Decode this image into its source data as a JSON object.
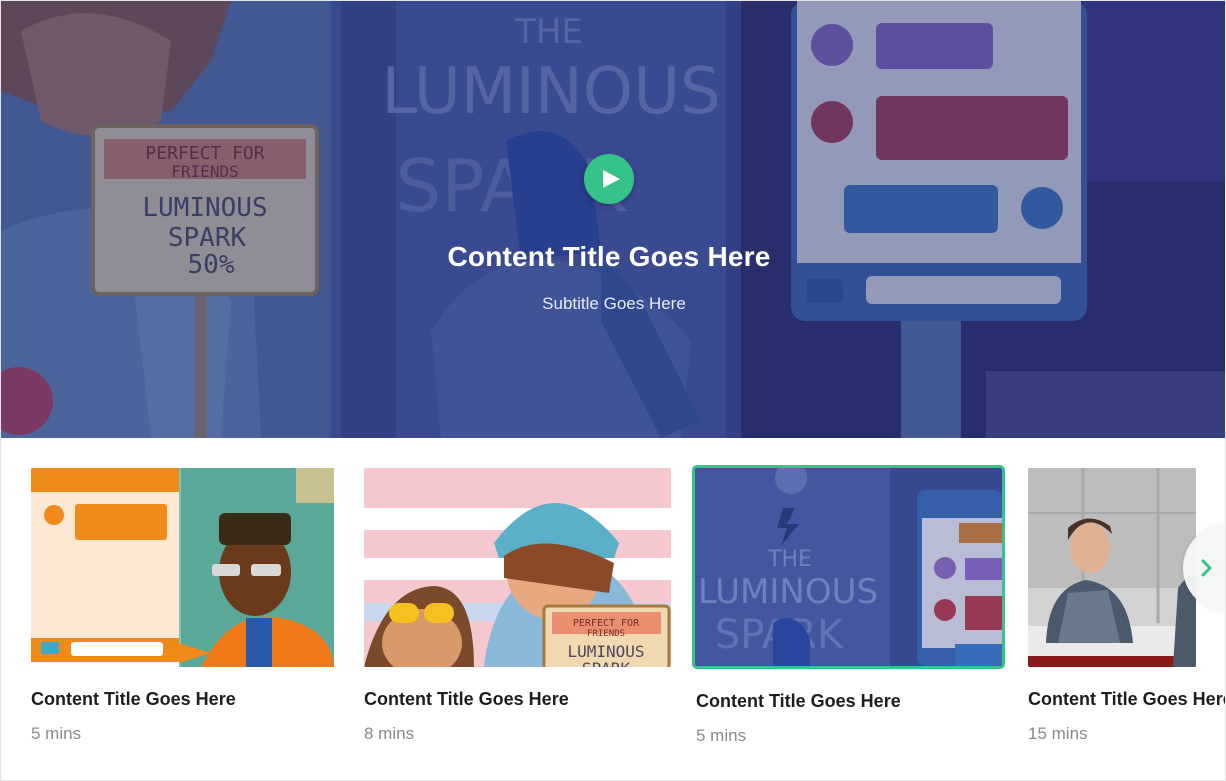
{
  "hero": {
    "title": "Content Title Goes Here",
    "subtitle": "Subtitle Goes Here",
    "art_sign": [
      "PERFECT FOR",
      "FRIENDS",
      "LUMINOUS",
      "SPARK",
      "50%"
    ],
    "art_poster": [
      "THE",
      "LUMINOUS",
      "SPARK"
    ]
  },
  "cards": [
    {
      "title": "Content Title Goes Here",
      "duration": "5 mins",
      "selected": false
    },
    {
      "title": "Content Title Goes Here",
      "duration": "8 mins",
      "selected": false,
      "art_sign": [
        "PERFECT FOR",
        "FRIENDS",
        "LUMINOUS",
        "SPARK"
      ]
    },
    {
      "title": "Content Title Goes Here",
      "duration": "5 mins",
      "selected": true,
      "art_poster": [
        "THE",
        "LUMINOUS",
        "SPARK"
      ]
    },
    {
      "title": "Content Title Goes Here",
      "duration": "15 mins",
      "selected": false
    }
  ],
  "colors": {
    "accent": "#35c38a",
    "title_text": "#1e1e1e",
    "meta_text": "#8a8a8a"
  },
  "icons": {
    "play": "play-icon",
    "next": "chevron-right-icon"
  }
}
